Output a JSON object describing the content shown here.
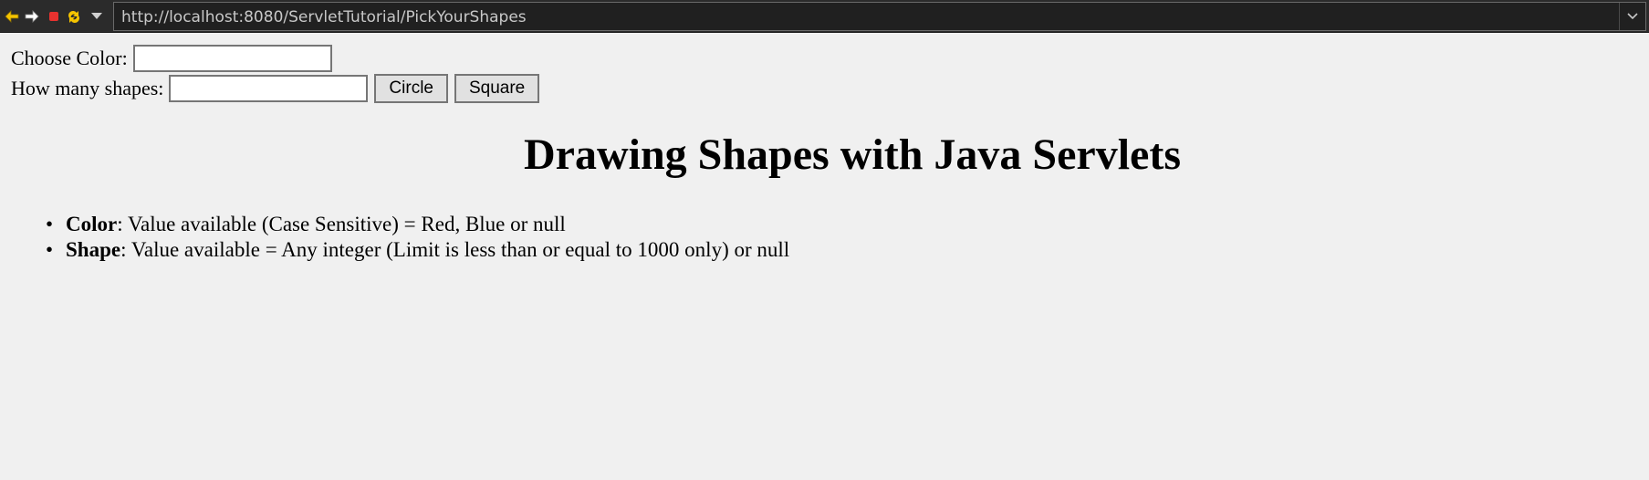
{
  "browser": {
    "url": "http://localhost:8080/ServletTutorial/PickYourShapes",
    "icons": [
      "back-arrow-icon",
      "forward-arrow-icon",
      "stop-icon",
      "refresh-icon",
      "menu-dropdown-icon",
      "url-dropdown-icon"
    ],
    "colors": {
      "toolbar_bg": "#2b2b2b",
      "back_forward": "#f5c400",
      "stop": "#e8322f",
      "refresh": "#f5c400"
    }
  },
  "form": {
    "color_label": "Choose Color:",
    "color_value": "",
    "count_label": "How many shapes:",
    "count_value": "",
    "circle_label": "Circle",
    "square_label": "Square"
  },
  "heading": "Drawing Shapes with Java Servlets",
  "info": [
    {
      "term": "Color",
      "desc": ": Value available (Case Sensitive) = Red, Blue or null"
    },
    {
      "term": "Shape",
      "desc": ": Value available = Any integer (Limit is less than or equal to 1000 only) or null"
    }
  ]
}
